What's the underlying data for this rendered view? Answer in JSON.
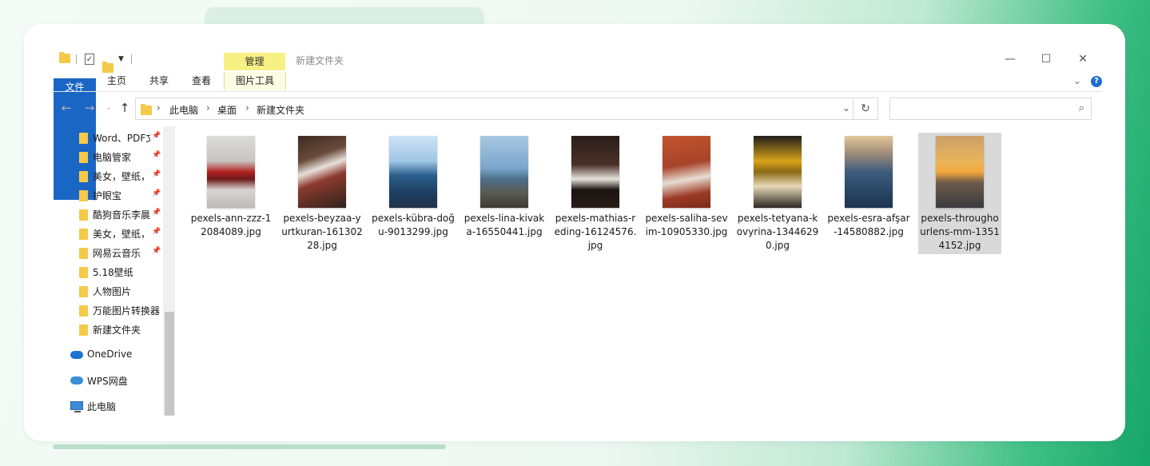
{
  "window": {
    "title": "新建文件夹",
    "manage_tab": "管理",
    "minimize": "—",
    "maximize": "☐",
    "close": "✕"
  },
  "ribbon": {
    "tabs": [
      "文件",
      "主页",
      "共享",
      "查看",
      "图片工具"
    ],
    "help": "?"
  },
  "address": {
    "crumbs": [
      "此电脑",
      "桌面",
      "新建文件夹"
    ],
    "search_placeholder": ""
  },
  "nav": {
    "quick_access": [
      {
        "label": "Word、PDF文",
        "pinned": true
      },
      {
        "label": "电脑管家",
        "pinned": true
      },
      {
        "label": "美女，壁纸，",
        "pinned": true
      },
      {
        "label": "护眼宝",
        "pinned": true
      },
      {
        "label": "酷狗音乐李晨",
        "pinned": true
      },
      {
        "label": "美女，壁纸，",
        "pinned": true
      },
      {
        "label": "网易云音乐",
        "pinned": true
      },
      {
        "label": "5.18壁纸",
        "pinned": false
      },
      {
        "label": "人物图片",
        "pinned": false
      },
      {
        "label": "万能图片转换器",
        "pinned": false
      },
      {
        "label": "新建文件夹",
        "pinned": false
      }
    ],
    "onedrive": "OneDrive",
    "wps": "WPS网盘",
    "this_pc": "此电脑"
  },
  "files": [
    {
      "name": "pexels-ann-zzz-12084089.jpg",
      "selected": false
    },
    {
      "name": "pexels-beyzaa-yurtkuran-16130228.jpg",
      "selected": false
    },
    {
      "name": "pexels-kübra-doğu-9013299.jpg",
      "selected": false
    },
    {
      "name": "pexels-lina-kivaka-16550441.jpg",
      "selected": false
    },
    {
      "name": "pexels-mathias-reding-16124576.jpg",
      "selected": false
    },
    {
      "name": "pexels-saliha-sevim-10905330.jpg",
      "selected": false
    },
    {
      "name": "pexels-tetyana-kovyrina-13446290.jpg",
      "selected": false
    },
    {
      "name": "pexels-esra-afşar-14580882.jpg",
      "selected": false
    },
    {
      "name": "pexels-throughourlens-mm-13514152.jpg",
      "selected": true
    }
  ],
  "colors": {
    "file_tab": "#1a66c4",
    "manage_tab": "#f7f083",
    "folder": "#f5c94a",
    "selection": "#d9d9d9"
  }
}
